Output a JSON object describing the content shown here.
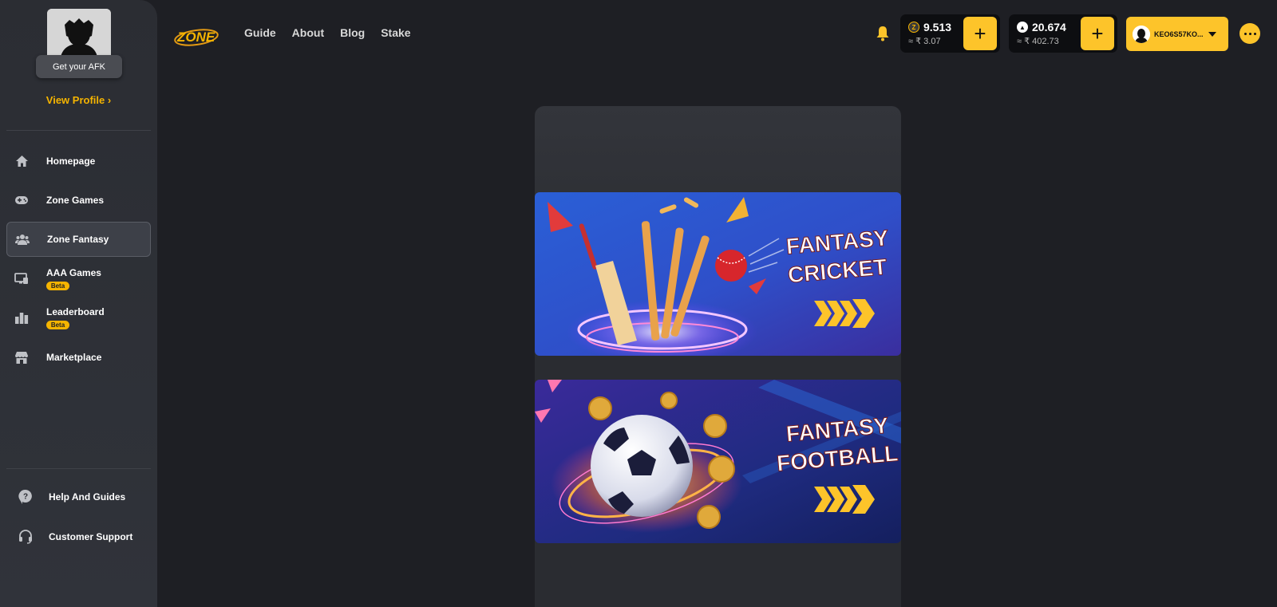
{
  "sidebar": {
    "afk_button": "Get your AFK",
    "view_profile": "View Profile",
    "items": [
      {
        "label": "Homepage",
        "icon": "home-icon"
      },
      {
        "label": "Zone Games",
        "icon": "gamepad-icon"
      },
      {
        "label": "Zone Fantasy",
        "icon": "fantasy-icon",
        "active": true
      },
      {
        "label": "AAA Games",
        "icon": "monitor-icon",
        "badge": "Beta"
      },
      {
        "label": "Leaderboard",
        "icon": "leaderboard-icon",
        "badge": "Beta"
      },
      {
        "label": "Marketplace",
        "icon": "store-icon"
      }
    ],
    "footer_items": [
      {
        "label": "Help And Guides",
        "icon": "help-icon"
      },
      {
        "label": "Customer Support",
        "icon": "headset-icon"
      }
    ]
  },
  "header": {
    "logo_text": "ZONE",
    "nav": [
      "Guide",
      "About",
      "Blog",
      "Stake"
    ],
    "wallets": [
      {
        "amount": "9.513",
        "fiat": "≈ ₹ 3.07",
        "icon": "zone-coin-icon"
      },
      {
        "amount": "20.674",
        "fiat": "≈ ₹ 402.73",
        "icon": "avax-coin-icon"
      }
    ],
    "user": {
      "name": "KEO6S57KO..."
    }
  },
  "banners": [
    {
      "line1": "FANTASY",
      "line2": "CRICKET"
    },
    {
      "line1": "FANTASY",
      "line2": "FOOTBALL"
    }
  ],
  "colors": {
    "accent": "#fdc42a",
    "sidebar_bg": "#2b2d33",
    "page_bg": "#1e1f24",
    "profile_link": "#f5b400"
  }
}
